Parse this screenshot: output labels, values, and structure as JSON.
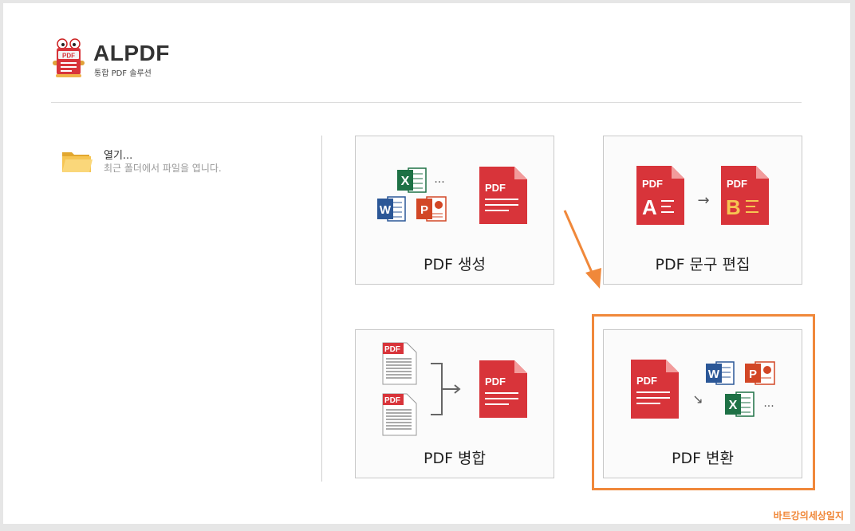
{
  "app": {
    "title": "ALPDF",
    "subtitle": "통합 PDF 솔루션",
    "logo_badge": "PDF"
  },
  "open": {
    "title": "열기...",
    "desc": "최근 폴더에서 파일을 엽니다."
  },
  "tiles": [
    {
      "label": "PDF 생성"
    },
    {
      "label": "PDF 문구 편집"
    },
    {
      "label": "PDF 병합"
    },
    {
      "label": "PDF 변환"
    }
  ],
  "icons": {
    "pdf_text": "PDF",
    "word": "W",
    "excel": "X",
    "ppt": "P",
    "ellipsis": "...",
    "letter_a": "A",
    "letter_b": "B",
    "arrow_right": "→",
    "arrow_diag": "↘"
  },
  "colors": {
    "pdf_red": "#d8343a",
    "highlight": "#f0883a",
    "word": "#2b5797",
    "excel": "#1e7145",
    "ppt": "#d24726"
  },
  "watermark": "바트강의세상일지"
}
